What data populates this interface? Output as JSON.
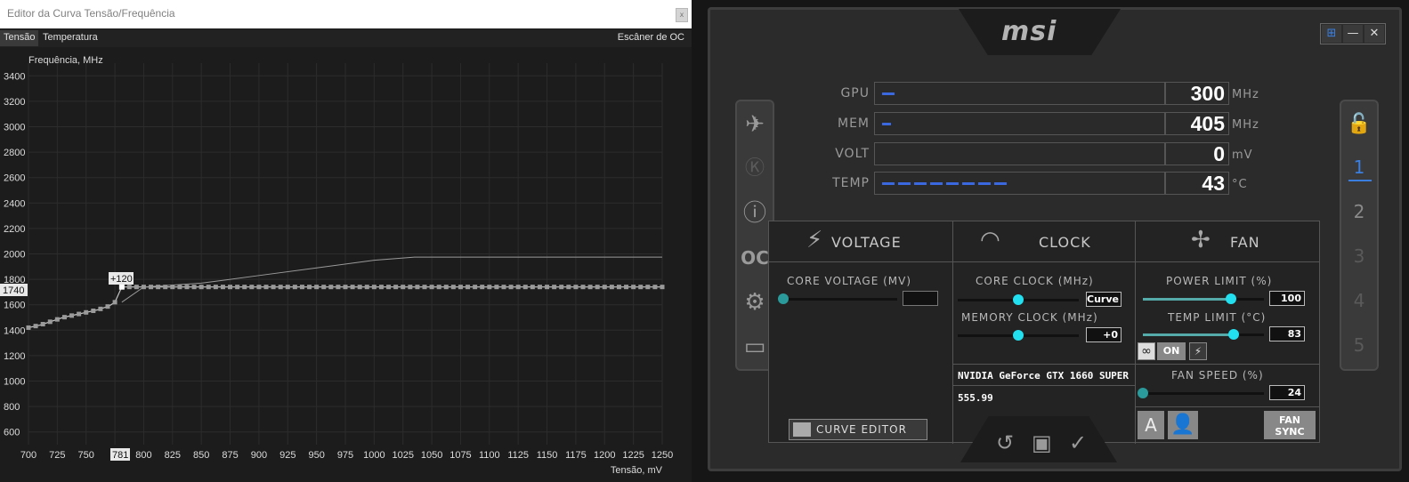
{
  "curve_editor": {
    "title": "Editor da Curva Tensão/Frequência",
    "close_label": "x",
    "tabs": [
      "Tensão",
      "Temperatura"
    ],
    "scanner_label": "Escâner de OC",
    "y_axis_label": "Frequência, MHz",
    "x_axis_label": "Tensão, mV",
    "selected_x_label": "781",
    "selected_y_label": "1740",
    "offset_label": "+120",
    "chart_data": {
      "type": "line",
      "xlabel": "Tensão, mV",
      "ylabel": "Frequência, MHz",
      "xlim": [
        700,
        1250
      ],
      "ylim": [
        500,
        3500
      ],
      "x_ticks": [
        700,
        725,
        750,
        775,
        800,
        825,
        850,
        875,
        900,
        925,
        950,
        975,
        1000,
        1025,
        1050,
        1075,
        1100,
        1125,
        1150,
        1175,
        1200,
        1225,
        1250
      ],
      "x_tick_labels": [
        "700",
        "725",
        "750",
        "7",
        "800",
        "825",
        "850",
        "875",
        "900",
        "925",
        "950",
        "975",
        "1000",
        "1025",
        "1050",
        "1075",
        "1100",
        "1125",
        "1150",
        "1175",
        "1200",
        "1225",
        "1250"
      ],
      "y_ticks": [
        600,
        800,
        1000,
        1200,
        1400,
        1600,
        1800,
        2000,
        2200,
        2400,
        2600,
        2800,
        3000,
        3200,
        3400
      ],
      "grid": true,
      "series": [
        {
          "role": "edited",
          "x": [
            700,
            710,
            720,
            730,
            740,
            750,
            760,
            770,
            775,
            781,
            800,
            850,
            900,
            950,
            1000,
            1050,
            1100,
            1150,
            1200,
            1250
          ],
          "y": [
            1420,
            1440,
            1470,
            1500,
            1520,
            1540,
            1560,
            1590,
            1620,
            1740,
            1740,
            1740,
            1740,
            1740,
            1740,
            1740,
            1740,
            1740,
            1740,
            1740
          ]
        },
        {
          "role": "default",
          "x": [
            781,
            800,
            850,
            900,
            950,
            1000,
            1035,
            1100,
            1250
          ],
          "y": [
            1620,
            1740,
            1770,
            1830,
            1890,
            1950,
            1975,
            1975,
            1975
          ]
        }
      ]
    }
  },
  "msi": {
    "logo": "msi",
    "window_controls": [
      "⊞",
      "—",
      "✕"
    ],
    "monitors": [
      {
        "label": "GPU",
        "value": "300",
        "unit": "MHz",
        "fill": 0.05
      },
      {
        "label": "MEM",
        "value": "405",
        "unit": "MHz",
        "fill": 0.03
      },
      {
        "label": "VOLT",
        "value": "0",
        "unit": "mV",
        "fill": 0
      },
      {
        "label": "TEMP",
        "value": "43",
        "unit": "°C",
        "fill": 0.43
      }
    ],
    "profiles": [
      "1",
      "2",
      "3",
      "4",
      "5"
    ],
    "active_profile": "1",
    "voltage": {
      "title": "VOLTAGE",
      "core_voltage_label": "CORE VOLTAGE  (MV)",
      "core_voltage_value": "",
      "level": 0
    },
    "clock": {
      "title": "CLOCK",
      "core_clock_label": "CORE CLOCK (MHz)",
      "core_clock_value": "Curve",
      "core_clock_level": 0.5,
      "memory_clock_label": "MEMORY CLOCK (MHz)",
      "memory_clock_value": "+0",
      "memory_clock_level": 0.5
    },
    "gpu_name": "NVIDIA GeForce GTX 1660 SUPER",
    "driver_version": "555.99",
    "fan": {
      "title": "FAN",
      "power_limit_label": "POWER LIMIT (%)",
      "power_limit_value": "100",
      "power_limit_level": 0.73,
      "temp_limit_label": "TEMP LIMIT (°C)",
      "temp_limit_value": "83",
      "temp_limit_level": 0.75,
      "link_on_label": "ON",
      "fan_speed_label": "FAN SPEED (%)",
      "fan_speed_value": "24",
      "fan_speed_level": 0,
      "auto_label": "A",
      "fan_sync_label": "FAN SYNC"
    },
    "curve_editor_button": "CURVE EDITOR"
  }
}
